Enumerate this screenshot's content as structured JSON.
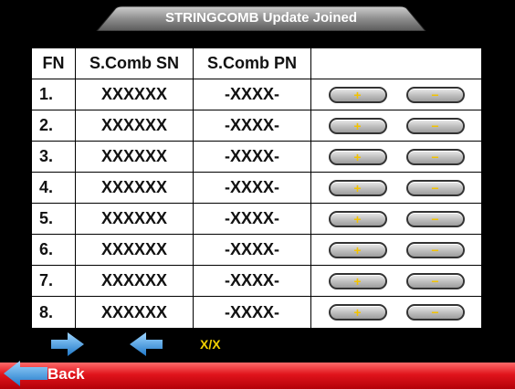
{
  "title": "STRINGCOMB Update Joined",
  "columns": [
    "FN",
    "S.Comb SN",
    "S.Comb PN"
  ],
  "rows": [
    {
      "fn": "1.",
      "sn": "XXXXXX",
      "pn": "-XXXX-"
    },
    {
      "fn": "2.",
      "sn": "XXXXXX",
      "pn": "-XXXX-"
    },
    {
      "fn": "3.",
      "sn": "XXXXXX",
      "pn": "-XXXX-"
    },
    {
      "fn": "4.",
      "sn": "XXXXXX",
      "pn": "-XXXX-"
    },
    {
      "fn": "5.",
      "sn": "XXXXXX",
      "pn": "-XXXX-"
    },
    {
      "fn": "6.",
      "sn": "XXXXXX",
      "pn": "-XXXX-"
    },
    {
      "fn": "7.",
      "sn": "XXXXXX",
      "pn": "-XXXX-"
    },
    {
      "fn": "8.",
      "sn": "XXXXXX",
      "pn": "-XXXX-"
    }
  ],
  "plus_label": "+",
  "minus_label": "−",
  "page_indicator": "X/X",
  "back_label": "Back",
  "icons": {
    "next": "arrow-right-icon",
    "prev": "arrow-left-icon",
    "back": "back-arrow-icon"
  },
  "colors": {
    "background": "#000000",
    "accent_yellow": "#f2c200",
    "arrow_blue": "#4aa8e8",
    "bar_red": "#e0141c"
  }
}
